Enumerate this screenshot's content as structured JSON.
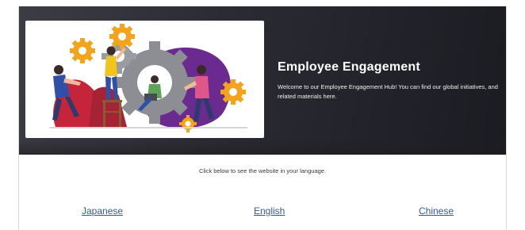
{
  "hero": {
    "title": "Employee Engagement",
    "description": "Welcome to our Employee Engagement Hub! You can find our global initiatives, and related materials here."
  },
  "instruction": "Click below to see the website in your language.",
  "languages": [
    {
      "label": "Japanese"
    },
    {
      "label": "English"
    },
    {
      "label": "Chinese"
    }
  ],
  "colors": {
    "hero_background": "#2b2c33",
    "link": "#2b5c9e",
    "gear_gray": "#8c8e94",
    "gear_orange": "#f3a41b",
    "accent_purple": "#6b2a8f",
    "accent_red": "#c5243b"
  },
  "illustration_icon": "team-gears-illustration"
}
